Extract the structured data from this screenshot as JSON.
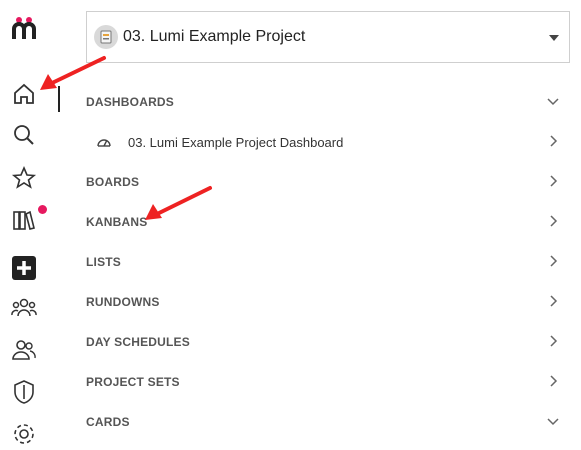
{
  "project_selector": {
    "name": "03. Lumi Example Project"
  },
  "sidebar_icons": [
    "logo-icon",
    "home-icon",
    "search-icon",
    "star-icon",
    "library-icon",
    "add-icon",
    "team-icon",
    "users-icon",
    "shield-icon",
    "settings-icon"
  ],
  "sections": [
    {
      "label": "DASHBOARDS",
      "expanded": true
    },
    {
      "label": "BOARDS",
      "expanded": false
    },
    {
      "label": "KANBANS",
      "expanded": false
    },
    {
      "label": "LISTS",
      "expanded": false
    },
    {
      "label": "RUNDOWNS",
      "expanded": false
    },
    {
      "label": "DAY SCHEDULES",
      "expanded": false
    },
    {
      "label": "PROJECT SETS",
      "expanded": false
    },
    {
      "label": "CARDS",
      "expanded": true
    }
  ],
  "dashboard_item": {
    "label": "03. Lumi Example Project Dashboard"
  },
  "colors": {
    "notification_dot": "#e6195f",
    "annotation_arrow": "#ee2222"
  }
}
